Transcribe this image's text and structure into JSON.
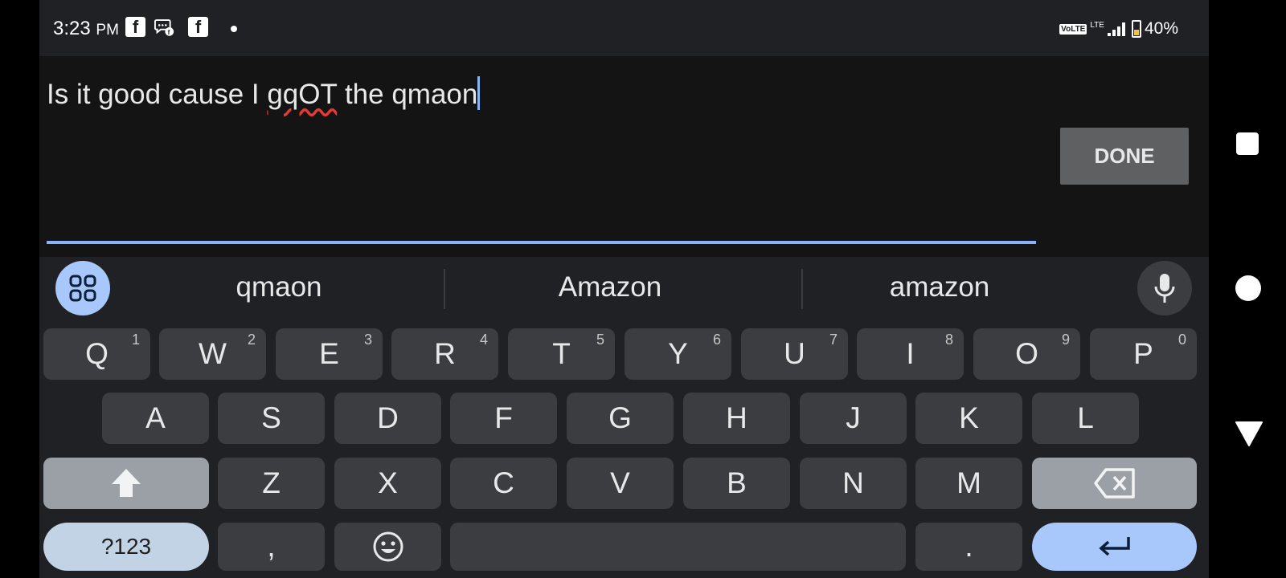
{
  "status_bar": {
    "time": "3:23",
    "ampm": "PM",
    "volte": "VoLTE",
    "network": "LTE",
    "battery": "40%"
  },
  "editor": {
    "text_before": "Is it good cause I ",
    "misspelled_word": "gqOT",
    "text_after": " the qmaon",
    "done_label": "DONE"
  },
  "suggestions": [
    "qmaon",
    "Amazon",
    "amazon"
  ],
  "keyboard": {
    "row1": [
      {
        "label": "Q",
        "num": "1"
      },
      {
        "label": "W",
        "num": "2"
      },
      {
        "label": "E",
        "num": "3"
      },
      {
        "label": "R",
        "num": "4"
      },
      {
        "label": "T",
        "num": "5"
      },
      {
        "label": "Y",
        "num": "6"
      },
      {
        "label": "U",
        "num": "7"
      },
      {
        "label": "I",
        "num": "8"
      },
      {
        "label": "O",
        "num": "9"
      },
      {
        "label": "P",
        "num": "0"
      }
    ],
    "row2": [
      "A",
      "S",
      "D",
      "F",
      "G",
      "H",
      "J",
      "K",
      "L"
    ],
    "row3": [
      "Z",
      "X",
      "C",
      "V",
      "B",
      "N",
      "M"
    ],
    "symbols_label": "?123",
    "comma": ",",
    "period": "."
  }
}
